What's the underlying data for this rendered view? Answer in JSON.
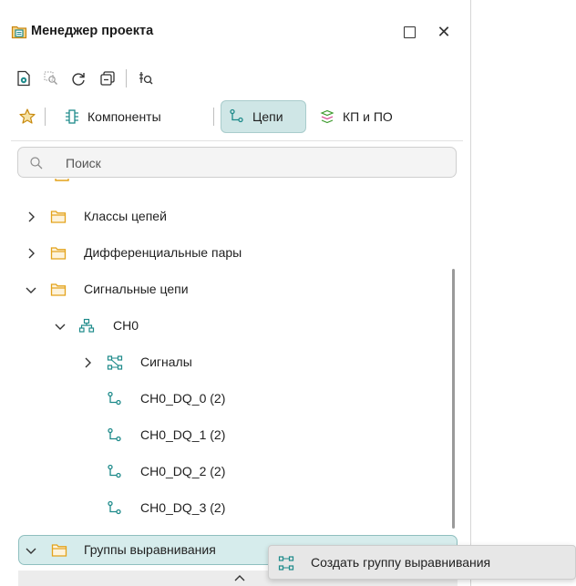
{
  "window": {
    "title": "Менеджер проекта"
  },
  "toolbar": {
    "icons": [
      "file-view-icon",
      "zoom-selection-icon",
      "refresh-icon",
      "collapse-icon",
      "find-component-icon"
    ]
  },
  "tabs": [
    {
      "label": "Компоненты",
      "icon": "components-icon",
      "active": false
    },
    {
      "label": "Цепи",
      "icon": "net-icon",
      "active": true
    },
    {
      "label": "КП и ПО",
      "icon": "pads-icon",
      "active": false
    }
  ],
  "search": {
    "placeholder": "Поиск"
  },
  "tree": {
    "items": [
      {
        "label": "Классы цепей"
      },
      {
        "label": "Дифференциальные пары"
      },
      {
        "label": "Сигнальные цепи"
      },
      {
        "label": "CH0"
      },
      {
        "label": "Сигналы"
      },
      {
        "label": "CH0_DQ_0 (2)"
      },
      {
        "label": "CH0_DQ_1 (2)"
      },
      {
        "label": "CH0_DQ_2 (2)"
      },
      {
        "label": "CH0_DQ_3 (2)"
      },
      {
        "label": "Группы выравнивания"
      }
    ]
  },
  "context_menu": {
    "items": [
      {
        "label": "Создать группу выравнивания"
      }
    ]
  },
  "colors": {
    "accent": "#cfe6e6",
    "accent_border": "#8fbfbf",
    "folder": "#e3a21a",
    "net_icon": "#1d8a8a"
  }
}
